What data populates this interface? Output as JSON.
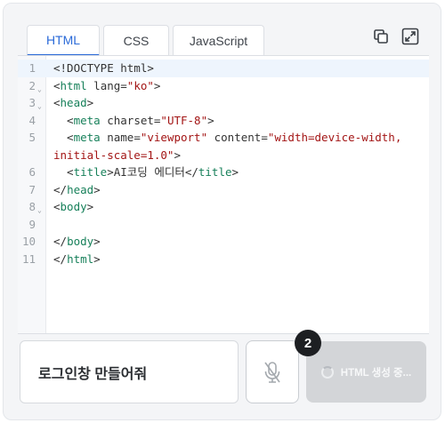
{
  "tabs": [
    {
      "label": "HTML",
      "active": true
    },
    {
      "label": "CSS",
      "active": false
    },
    {
      "label": "JavaScript",
      "active": false
    }
  ],
  "toolbar": {
    "copy_icon": "copy-icon",
    "expand_icon": "expand-icon"
  },
  "editor": {
    "lines": [
      {
        "num": "1",
        "fold": "",
        "segments": [
          [
            "punct",
            "<!DOCTYPE html>"
          ]
        ]
      },
      {
        "num": "2",
        "fold": "v",
        "segments": [
          [
            "punct",
            "<"
          ],
          [
            "tag",
            "html"
          ],
          [
            "attr",
            " lang="
          ],
          [
            "str",
            "\"ko\""
          ],
          [
            "punct",
            ">"
          ]
        ]
      },
      {
        "num": "3",
        "fold": "v",
        "segments": [
          [
            "punct",
            "<"
          ],
          [
            "tag",
            "head"
          ],
          [
            "punct",
            ">"
          ]
        ]
      },
      {
        "num": "4",
        "fold": "",
        "segments": [
          [
            "punct",
            "  <"
          ],
          [
            "tag",
            "meta"
          ],
          [
            "attr",
            " charset="
          ],
          [
            "str",
            "\"UTF-8\""
          ],
          [
            "punct",
            ">"
          ]
        ]
      },
      {
        "num": "5",
        "fold": "",
        "segments": [
          [
            "punct",
            "  <"
          ],
          [
            "tag",
            "meta"
          ],
          [
            "attr",
            " name="
          ],
          [
            "str",
            "\"viewport\""
          ],
          [
            "attr",
            " content="
          ],
          [
            "str",
            "\"width=device-width,"
          ]
        ]
      },
      {
        "num": "",
        "fold": "",
        "segments": [
          [
            "str",
            "initial-scale=1.0\""
          ],
          [
            "punct",
            ">"
          ]
        ]
      },
      {
        "num": "6",
        "fold": "",
        "segments": [
          [
            "punct",
            "  <"
          ],
          [
            "tag",
            "title"
          ],
          [
            "punct",
            ">AI코딩 에디터</"
          ],
          [
            "tag",
            "title"
          ],
          [
            "punct",
            ">"
          ]
        ]
      },
      {
        "num": "7",
        "fold": "",
        "segments": [
          [
            "punct",
            "</"
          ],
          [
            "tag",
            "head"
          ],
          [
            "punct",
            ">"
          ]
        ]
      },
      {
        "num": "8",
        "fold": "v",
        "segments": [
          [
            "punct",
            "<"
          ],
          [
            "tag",
            "body"
          ],
          [
            "punct",
            ">"
          ]
        ]
      },
      {
        "num": "9",
        "fold": "",
        "segments": []
      },
      {
        "num": "10",
        "fold": "",
        "segments": [
          [
            "punct",
            "</"
          ],
          [
            "tag",
            "body"
          ],
          [
            "punct",
            ">"
          ]
        ]
      },
      {
        "num": "11",
        "fold": "",
        "segments": [
          [
            "punct",
            "</"
          ],
          [
            "tag",
            "html"
          ],
          [
            "punct",
            ">"
          ]
        ]
      }
    ]
  },
  "prompt": {
    "text": "로그인창 만들어줘"
  },
  "mic": {
    "icon": "mic-off-icon"
  },
  "generate": {
    "label": "HTML 생성 중..."
  },
  "step_badge": "2"
}
